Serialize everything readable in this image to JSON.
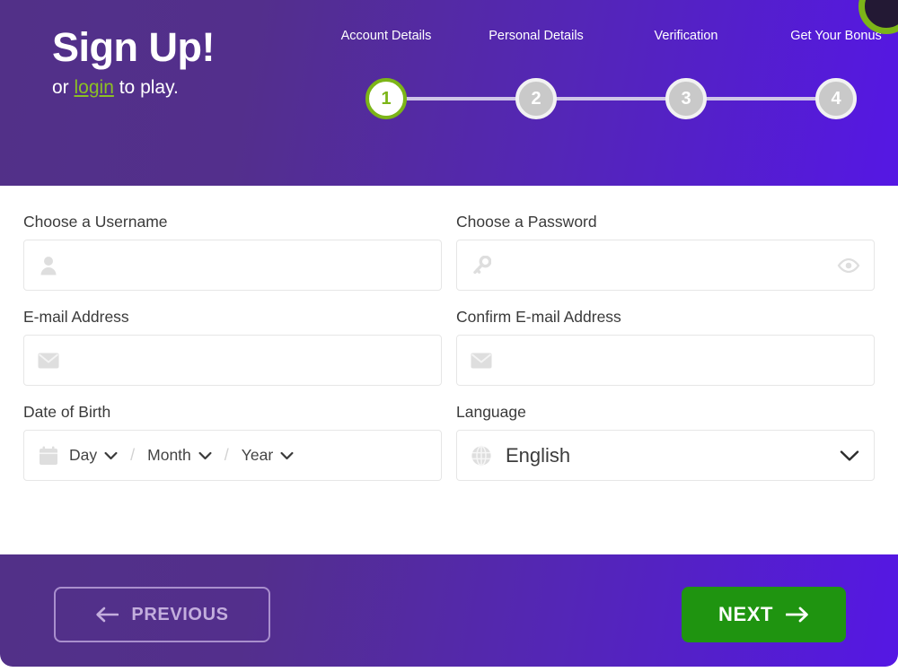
{
  "brand": {
    "title": "Sign Up!",
    "sub_prefix": "or ",
    "login_label": "login",
    "sub_suffix": " to play.",
    "accent_green": "#8CC024",
    "header_gradient_from": "#523088",
    "header_gradient_to": "#5517E4"
  },
  "stepper": {
    "current_step": 1,
    "steps": [
      {
        "number": "1",
        "label": "Account Details"
      },
      {
        "number": "2",
        "label": "Personal Details"
      },
      {
        "number": "3",
        "label": "Verification"
      },
      {
        "number": "4",
        "label": "Get Your Bonus"
      }
    ]
  },
  "form": {
    "username": {
      "label": "Choose a Username",
      "value": "",
      "placeholder": "",
      "icon": "person-icon"
    },
    "password": {
      "label": "Choose a Password",
      "value": "",
      "placeholder": "",
      "icon": "key-icon",
      "reveal_icon": "eye-icon"
    },
    "email": {
      "label": "E-mail Address",
      "value": "",
      "placeholder": "",
      "icon": "envelope-icon"
    },
    "email_confirm": {
      "label": "Confirm E-mail Address",
      "value": "",
      "placeholder": "",
      "icon": "envelope-icon"
    },
    "date_of_birth": {
      "label": "Date of Birth",
      "icon": "calendar-icon",
      "day": "Day",
      "month": "Month",
      "year": "Year",
      "separator": "/"
    },
    "language": {
      "label": "Language",
      "icon": "globe-icon",
      "value": "English"
    }
  },
  "footer": {
    "previous_label": "PREVIOUS",
    "previous_icon": "arrow-left-icon",
    "next_label": "NEXT",
    "next_icon": "arrow-right-icon",
    "next_color": "#1F9410"
  }
}
